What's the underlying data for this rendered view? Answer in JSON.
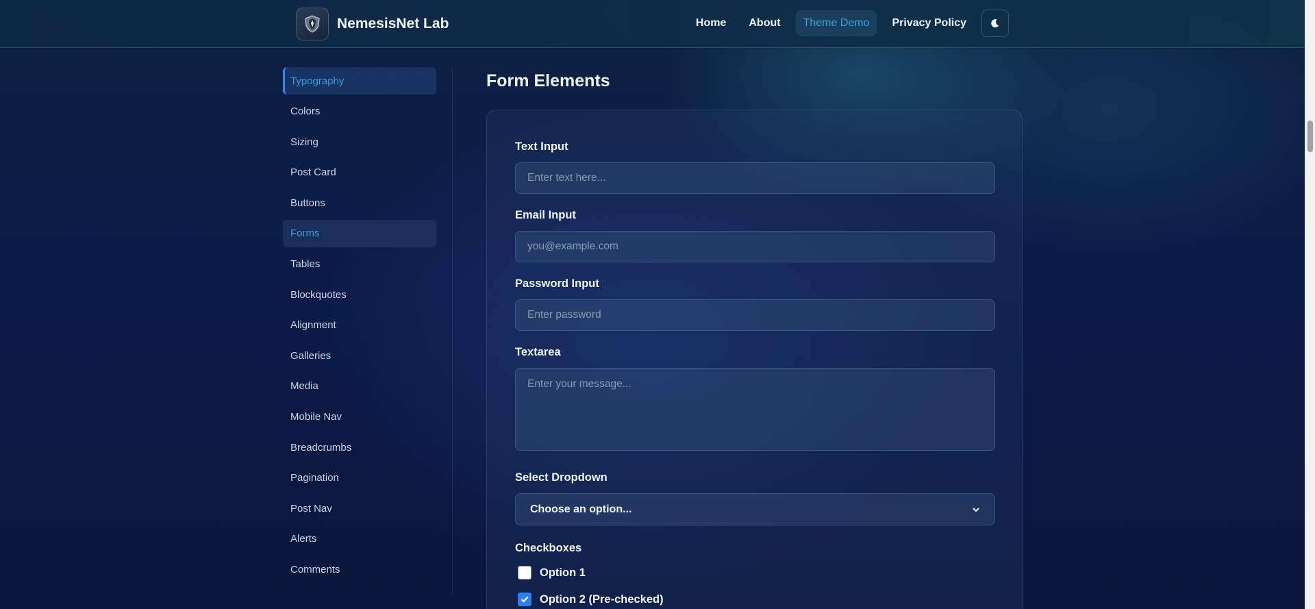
{
  "header": {
    "brand": "NemesisNet Lab",
    "logo_icon": "shield-logo-icon",
    "nav": [
      {
        "label": "Home",
        "active": false
      },
      {
        "label": "About",
        "active": false
      },
      {
        "label": "Theme Demo",
        "active": true
      },
      {
        "label": "Privacy Policy",
        "active": false
      }
    ],
    "theme_toggle_icon": "moon-icon"
  },
  "sidebar": {
    "items": [
      {
        "label": "Typography"
      },
      {
        "label": "Colors"
      },
      {
        "label": "Sizing"
      },
      {
        "label": "Post Card"
      },
      {
        "label": "Buttons"
      },
      {
        "label": "Forms"
      },
      {
        "label": "Tables"
      },
      {
        "label": "Blockquotes"
      },
      {
        "label": "Alignment"
      },
      {
        "label": "Galleries"
      },
      {
        "label": "Media"
      },
      {
        "label": "Mobile Nav"
      },
      {
        "label": "Breadcrumbs"
      },
      {
        "label": "Pagination"
      },
      {
        "label": "Post Nav"
      },
      {
        "label": "Alerts"
      },
      {
        "label": "Comments"
      }
    ]
  },
  "main": {
    "title": "Form Elements",
    "text_input": {
      "label": "Text Input",
      "placeholder": "Enter text here...",
      "value": ""
    },
    "email_input": {
      "label": "Email Input",
      "placeholder": "you@example.com",
      "value": ""
    },
    "password_input": {
      "label": "Password Input",
      "placeholder": "Enter password",
      "value": ""
    },
    "textarea": {
      "label": "Textarea",
      "placeholder": "Enter your message...",
      "value": ""
    },
    "select": {
      "label": "Select Dropdown",
      "selected": "Choose an option..."
    },
    "checkboxes": {
      "label": "Checkboxes",
      "options": [
        {
          "label": "Option 1",
          "checked": false
        },
        {
          "label": "Option 2 (Pre-checked)",
          "checked": true
        }
      ]
    }
  },
  "colors": {
    "accent": "#3b9fe0",
    "checkbox_checked": "#2f7ef0"
  }
}
